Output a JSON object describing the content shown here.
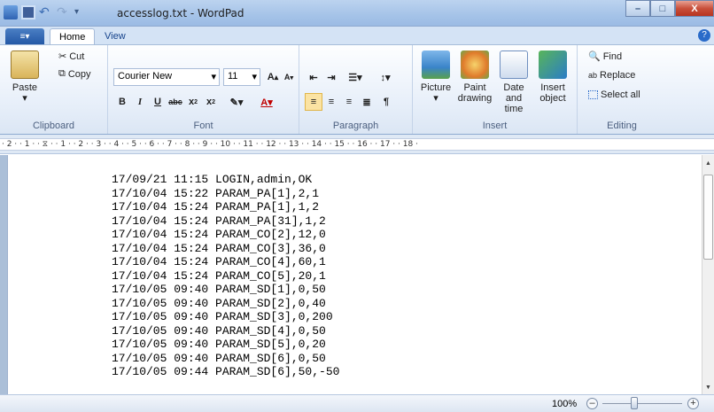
{
  "window": {
    "title": "accesslog.txt - WordPad",
    "minimize": "–",
    "maximize": "□",
    "close": "X"
  },
  "tabs": {
    "file_icon": "≡▾",
    "home": "Home",
    "view": "View",
    "help": "?"
  },
  "ribbon": {
    "clipboard": {
      "label": "Clipboard",
      "paste": "Paste",
      "cut": "Cut",
      "copy": "Copy"
    },
    "font": {
      "label": "Font",
      "family": "Courier New",
      "size": "11"
    },
    "paragraph": {
      "label": "Paragraph"
    },
    "insert": {
      "label": "Insert",
      "picture": "Picture",
      "paint_drawing_1": "Paint",
      "paint_drawing_2": "drawing",
      "datetime_1": "Date and",
      "datetime_2": "time",
      "insert_object_1": "Insert",
      "insert_object_2": "object"
    },
    "editing": {
      "label": "Editing",
      "find": "Find",
      "replace": "Replace",
      "select_all": "Select all"
    }
  },
  "ruler": {
    "text": "· 2 · · 1 · · ⧖ · · 1 · · 2 · · 3 · · 4 · · 5 · · 6 · · 7 · · 8 · · 9 · · 10 · · 11 · · 12 · · 13 · · 14 · · 15 · · 16 · · 17 · · 18 ·"
  },
  "document": {
    "lines": [
      "17/09/21 11:15 LOGIN,admin,OK",
      "17/10/04 15:22 PARAM_PA[1],2,1",
      "17/10/04 15:24 PARAM_PA[1],1,2",
      "17/10/04 15:24 PARAM_PA[31],1,2",
      "17/10/04 15:24 PARAM_CO[2],12,0",
      "17/10/04 15:24 PARAM_CO[3],36,0",
      "17/10/04 15:24 PARAM_CO[4],60,1",
      "17/10/04 15:24 PARAM_CO[5],20,1",
      "17/10/05 09:40 PARAM_SD[1],0,50",
      "17/10/05 09:40 PARAM_SD[2],0,40",
      "17/10/05 09:40 PARAM_SD[3],0,200",
      "17/10/05 09:40 PARAM_SD[4],0,50",
      "17/10/05 09:40 PARAM_SD[5],0,20",
      "17/10/05 09:40 PARAM_SD[6],0,50",
      "17/10/05 09:44 PARAM_SD[6],50,-50"
    ]
  },
  "status": {
    "zoom": "100%",
    "zoom_out": "–",
    "zoom_in": "+"
  },
  "colors": {
    "accent": "#2358a6",
    "close": "#c9503b"
  }
}
